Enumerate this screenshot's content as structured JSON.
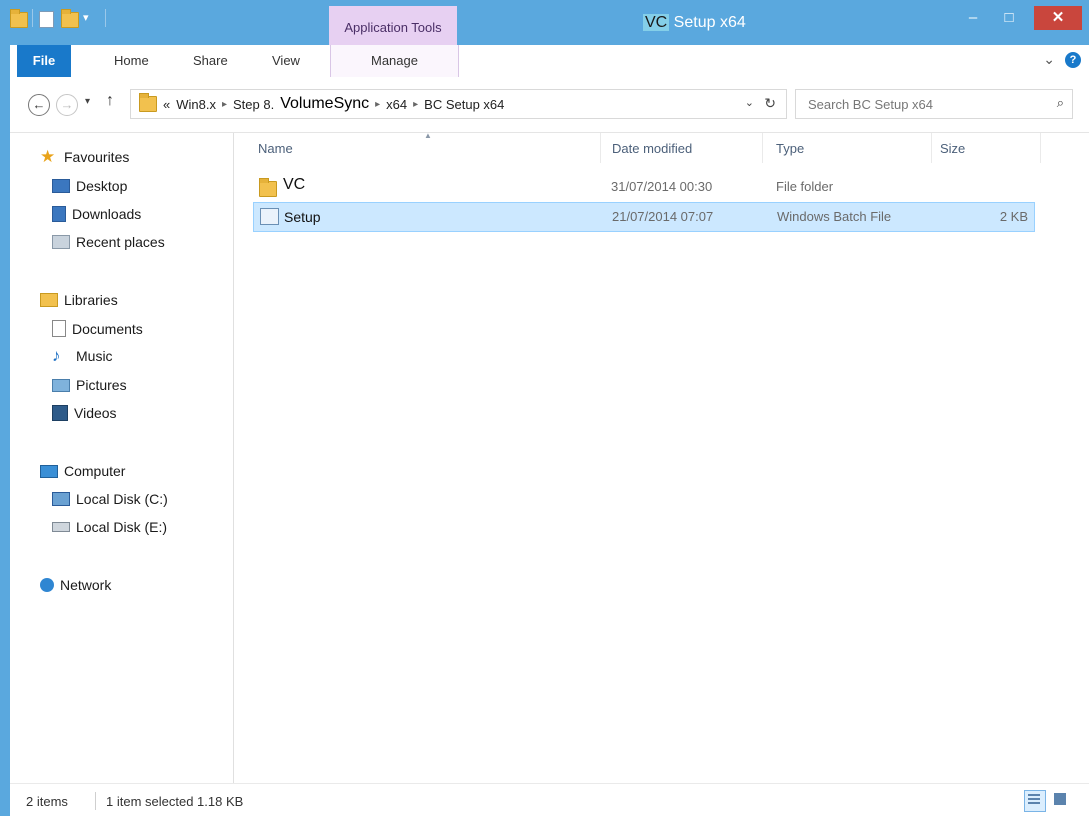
{
  "window": {
    "title_highlight": "VC",
    "title_rest": " Setup x64",
    "minimize": "–",
    "maximize": "□",
    "close": "✕"
  },
  "ribbon": {
    "context_group": "Application Tools",
    "tabs": [
      "File",
      "Home",
      "Share",
      "View",
      "Manage"
    ],
    "help": "?",
    "expand": "⌄"
  },
  "nav": {
    "back": "←",
    "forward": "→",
    "recent_dropdown": "▾",
    "up": "↑"
  },
  "address": {
    "overflow": "«",
    "crumbs": [
      "Win8.x",
      "Step 8.",
      "VolumeSync",
      "x64",
      "BC Setup x64"
    ],
    "dropdown": "⌄",
    "refresh": "↻"
  },
  "search": {
    "placeholder": "Search BC Setup x64",
    "icon": "⌕"
  },
  "navpane": {
    "favourites": "Favourites",
    "desktop": "Desktop",
    "downloads": "Downloads",
    "recent": "Recent places",
    "libraries": "Libraries",
    "documents": "Documents",
    "music": "Music",
    "pictures": "Pictures",
    "videos": "Videos",
    "computer": "Computer",
    "disk_c": "Local Disk (C:)",
    "disk_e": "Local Disk (E:)",
    "network": "Network"
  },
  "columns": {
    "name": "Name",
    "date": "Date modified",
    "type": "Type",
    "size": "Size"
  },
  "files": [
    {
      "name": "VC",
      "date": "31/07/2014 00:30",
      "type": "File folder",
      "size": ""
    },
    {
      "name": "Setup",
      "date": "21/07/2014 07:07",
      "type": "Windows Batch File",
      "size": "2 KB"
    }
  ],
  "status": {
    "items": "2 items",
    "selection": "1 item selected  1.18 KB"
  },
  "colors": {
    "titlebar": "#5aa8de",
    "context_tab": "#e7d0f2",
    "file_tab": "#1979ca",
    "selection": "#cce8ff",
    "close_button": "#c9463d"
  }
}
